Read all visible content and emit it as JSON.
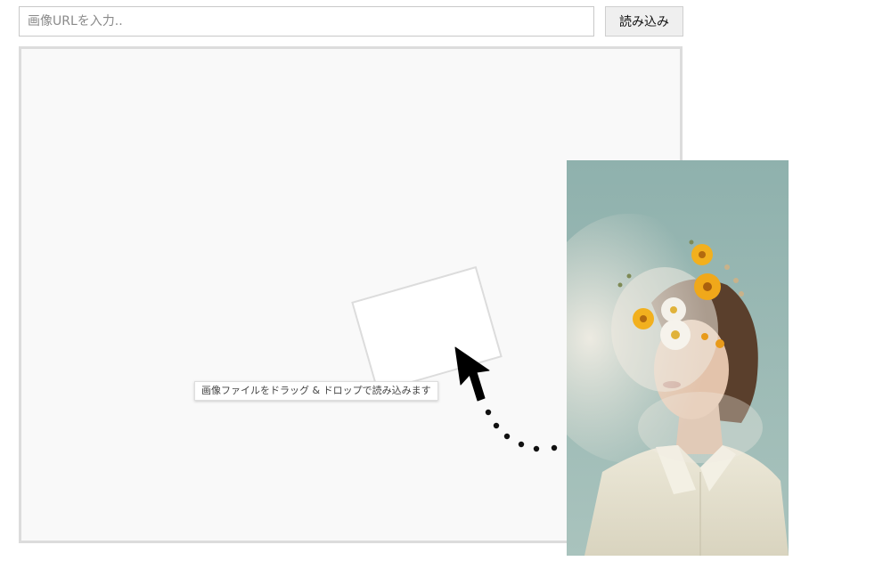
{
  "url_bar": {
    "placeholder": "画像URLを入力..",
    "value": ""
  },
  "load_button": {
    "label": "読み込み"
  },
  "drop_zone": {
    "hint": "画像ファイルをドラッグ & ドロップで読み込みます"
  },
  "colors": {
    "background": "#ffffff",
    "drop_zone_bg": "#f9f9f9",
    "drop_zone_border": "#dcdcdc",
    "button_bg": "#efefef",
    "photo_sky": "#8fb1ad",
    "flower_yellow": "#f2b01e",
    "flower_white": "#f4f1ea"
  },
  "icons": {
    "cursor": "arrow-cursor-icon",
    "path": "dotted-drag-path"
  }
}
